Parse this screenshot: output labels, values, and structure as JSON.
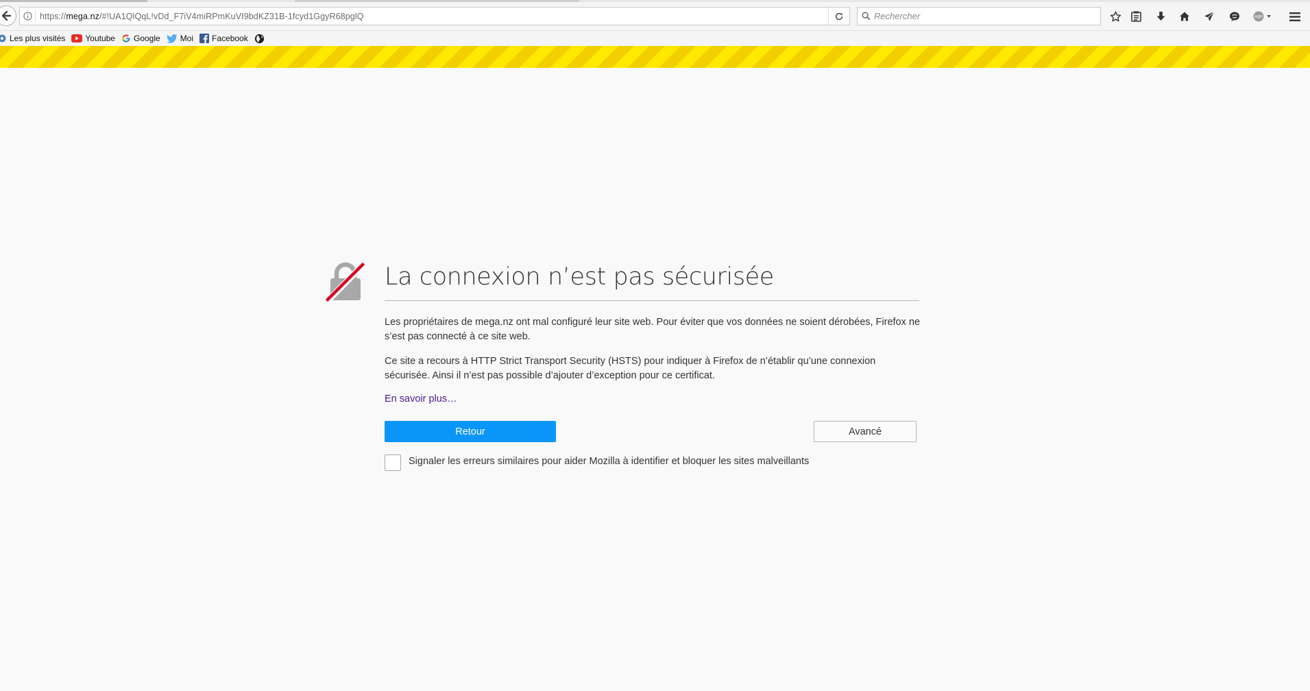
{
  "browser": {
    "url_prefix": "https://",
    "url_host": "mega.nz",
    "url_rest": "/#!UA1QlQqL!vDd_F7iV4miRPmKuVI9bdKZ31B-1fcyd1GgyR68pglQ",
    "search_placeholder": "Rechercher",
    "toolbar_icons": [
      "star-icon",
      "reading-list-icon",
      "download-icon",
      "home-icon",
      "send-icon",
      "chat-icon",
      "adblock-icon",
      "menu-icon"
    ]
  },
  "bookmarks": [
    {
      "label": "Les plus visités",
      "icon": "gear-icon"
    },
    {
      "label": "Youtube",
      "icon": "youtube-icon"
    },
    {
      "label": "Google",
      "icon": "google-icon"
    },
    {
      "label": "Moi",
      "icon": "twitter-icon"
    },
    {
      "label": "Facebook",
      "icon": "facebook-icon"
    }
  ],
  "error": {
    "title": "La connexion n’est pas sécurisée",
    "paragraph1": "Les propriétaires de mega.nz ont mal configuré leur site web. Pour éviter que vos données ne soient dérobées, Firefox ne s’est pas connecté à ce site web.",
    "paragraph2": "Ce site a recours à HTTP Strict Transport Security (HSTS) pour indiquer à Firefox de n’établir qu’une connexion sécurisée. Ainsi il n’est pas possible d’ajouter d’exception pour ce certificat.",
    "learn_more": "En savoir plus…",
    "back_button": "Retour",
    "advanced_button": "Avancé",
    "report_label": "Signaler les erreurs similaires pour aider Mozilla à identifier et bloquer les sites malveillants",
    "report_checked": false
  },
  "colors": {
    "primary_button": "#0996f8",
    "warning_stripe_a": "#ffe900",
    "warning_stripe_b": "#f3cf00",
    "broken_lock_slash": "#d70022",
    "link_visited": "#4a1a8b"
  }
}
